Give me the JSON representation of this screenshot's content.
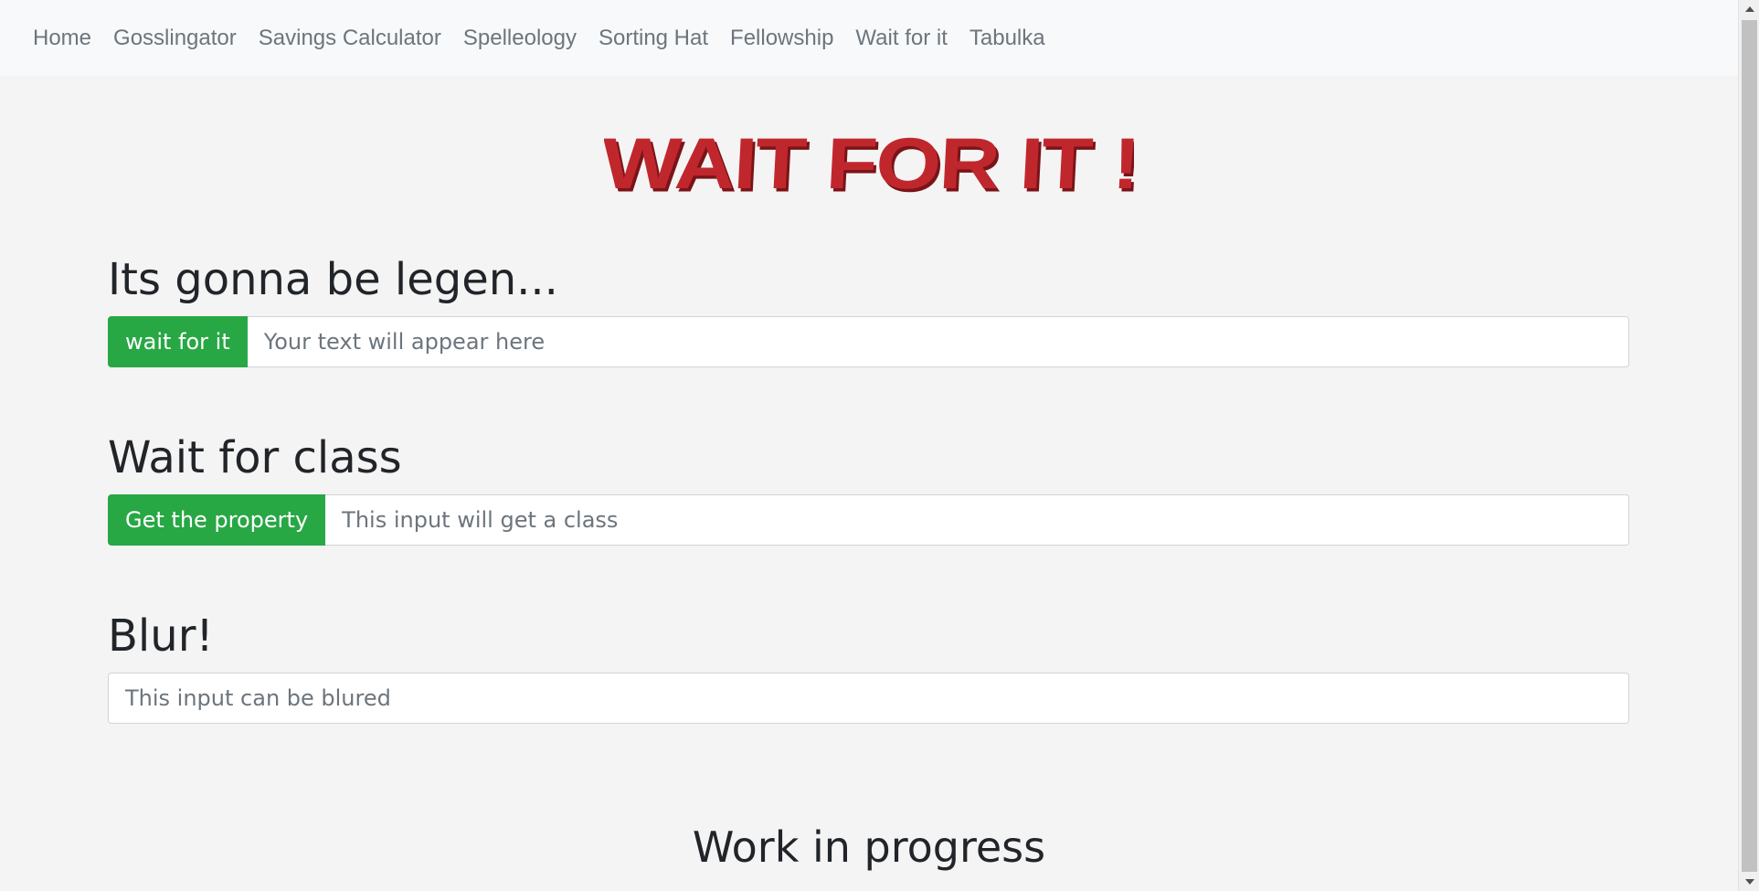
{
  "nav": {
    "items": [
      {
        "label": "Home"
      },
      {
        "label": "Gosslingator"
      },
      {
        "label": "Savings Calculator"
      },
      {
        "label": "Spelleology"
      },
      {
        "label": "Sorting Hat"
      },
      {
        "label": "Fellowship"
      },
      {
        "label": "Wait for it"
      },
      {
        "label": "Tabulka"
      }
    ]
  },
  "logo": {
    "text": "WAIT FOR IT !",
    "color": "#c0272d"
  },
  "sections": [
    {
      "heading": "Its gonna be legen...",
      "button_label": "wait for it",
      "input_placeholder": "Your text will appear here"
    },
    {
      "heading": "Wait for class",
      "button_label": "Get the property",
      "input_placeholder": "This input will get a class"
    },
    {
      "heading": "Blur!",
      "input_placeholder": "This input can be blured"
    }
  ],
  "footer": {
    "heading": "Work in progress"
  },
  "colors": {
    "accent_green": "#28a745",
    "background": "#f4f4f4",
    "navbar": "#f8f9fa"
  },
  "scrollbar": {
    "up_icon": "triangle-up-icon",
    "down_icon": "triangle-down-icon"
  }
}
